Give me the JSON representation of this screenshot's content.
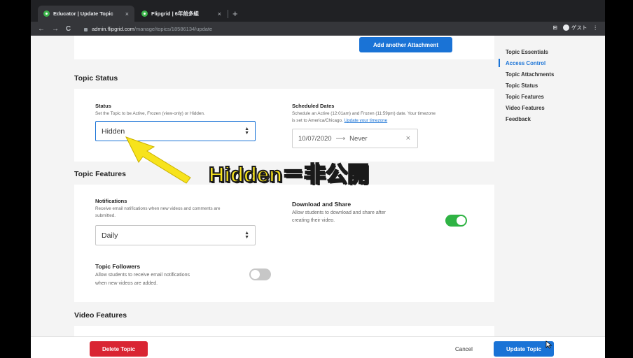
{
  "browser": {
    "tabs": [
      {
        "title": "Educator | Update Topic",
        "close": "×"
      },
      {
        "title": "Flipgrid | 6年前多組",
        "close": "×"
      }
    ],
    "new_tab": "+",
    "nav": {
      "back": "←",
      "forward": "→",
      "reload": "C"
    },
    "url_host": "admin.flipgrid.com",
    "url_path": "/manage/topics/18586134/update",
    "profile_label": "ゲスト",
    "menu": "⋮"
  },
  "attachments": {
    "add_button": "Add another Attachment"
  },
  "topic_status": {
    "title": "Topic Status",
    "status_label": "Status",
    "status_desc": "Set the Topic to be Active, Frozen (view-only) or Hidden.",
    "status_value": "Hidden",
    "scheduled_label": "Scheduled Dates",
    "scheduled_desc_1": "Schedule an Active (12:01am) and Frozen (11:59pm) date. Your timezone",
    "scheduled_desc_2": "is set to America/Chicago.",
    "timezone_link": "Update your timezone",
    "date_start": "10/07/2020",
    "date_arrow": "⟶",
    "date_end": "Never",
    "date_clear": "×"
  },
  "topic_features": {
    "title": "Topic Features",
    "notifications_label": "Notifications",
    "notifications_desc_1": "Receive email notifications when new videos and comments are",
    "notifications_desc_2": "submitted.",
    "notifications_value": "Daily",
    "download_label": "Download and Share",
    "download_desc_1": "Allow students to download and share after",
    "download_desc_2": "creating their video.",
    "download_enabled": true,
    "followers_label": "Topic Followers",
    "followers_desc_1": "Allow students to receive email notifications",
    "followers_desc_2": "when new videos are added.",
    "followers_enabled": false
  },
  "video_features": {
    "title": "Video Features"
  },
  "sidenav": {
    "items": [
      "Topic Essentials",
      "Access Control",
      "Topic Attachments",
      "Topic Status",
      "Topic Features",
      "Video Features",
      "Feedback"
    ],
    "active_index": 1
  },
  "footer": {
    "delete": "Delete Topic",
    "cancel": "Cancel",
    "update": "Update Topic"
  },
  "annotation": {
    "text": "Hidden＝非公開"
  },
  "colors": {
    "primary": "#1a73d6",
    "danger": "#d92533",
    "toggle_on": "#2fb344",
    "toggle_off": "#c7c7c7",
    "annotation": "#f7e31c"
  }
}
